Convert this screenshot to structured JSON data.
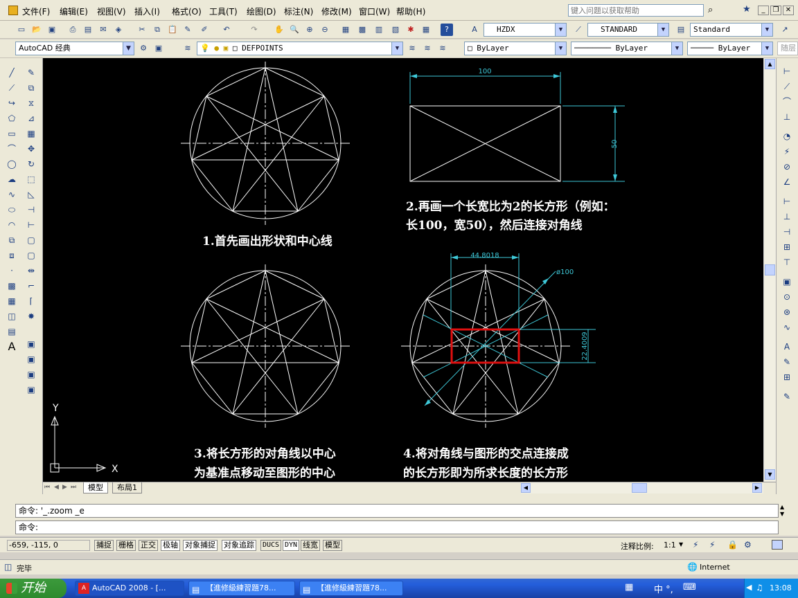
{
  "menu": [
    "文件(F)",
    "编辑(E)",
    "视图(V)",
    "插入(I)",
    "格式(O)",
    "工具(T)",
    "绘图(D)",
    "标注(N)",
    "修改(M)",
    "窗口(W)",
    "帮助(H)"
  ],
  "help_search_placeholder": "键入问题以获取帮助",
  "toolbar": {
    "text_style": "HZDX",
    "dim_style": "STANDARD",
    "table_style": "Standard",
    "workspace": "AutoCAD 经典",
    "layer": "DEFPOINTS",
    "color": "ByLayer",
    "linetype": "ByLayer",
    "lineweight": "ByLayer",
    "plot_style": "随层"
  },
  "drawing": {
    "step1": "1.首先画出形状和中心线",
    "step2_line1": "2.再画一个长宽比为2的长方形（例如：",
    "step2_line2": "长100，宽50），然后连接对角线",
    "step3_line1": "3.将长方形的对角线以中心",
    "step3_line2": "为基准点移动至图形的中心",
    "step4_line1": "4.将对角线与图形的交点连接成",
    "step4_line2": "的长方形即为所求长度的长方形",
    "dim_width": "100",
    "dim_height": "50",
    "dim_rect_w": "44.8018",
    "dim_rect_h": "22.4009",
    "dim_diameter": "ø100",
    "axis_x": "X",
    "axis_y": "Y"
  },
  "tabs": [
    "模型",
    "布局1"
  ],
  "command": {
    "line1": "命令: '_.zoom _e",
    "line2": "命令:"
  },
  "status": {
    "coords": "-659,  -115, 0",
    "buttons": [
      "捕捉",
      "栅格",
      "正交",
      "极轴",
      "对象捕捉",
      "对象追踪",
      "DUCS",
      "DYN",
      "线宽",
      "模型"
    ],
    "annotation_scale_label": "注释比例:",
    "annotation_scale": "1:1"
  },
  "window_status": {
    "left": "完毕",
    "zone": "Internet"
  },
  "taskbar": {
    "start": "开始",
    "tasks": [
      "AutoCAD 2008 - [...",
      "【進修級練習題78...",
      "【進修級練習題78..."
    ],
    "ime": "中 °,",
    "clock": "13:08"
  },
  "colors": {
    "canvas_bg": "#000000",
    "geometry": "#ffffff",
    "dimension": "#3ec8d8",
    "highlight_rect": "#e01010"
  }
}
